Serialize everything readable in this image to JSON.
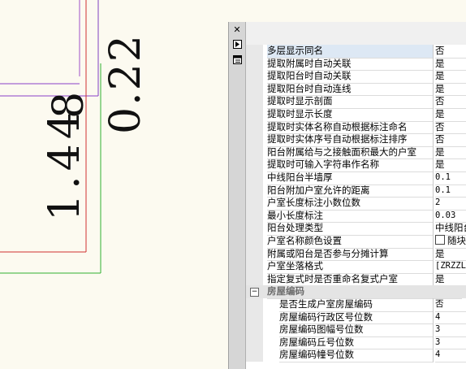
{
  "canvas": {
    "text_1": "1.44",
    "text_1_dot": "8",
    "text_2": "0.22"
  },
  "panel": {
    "close_glyph": "✕",
    "properties": [
      {
        "name": "多层显示同名",
        "value": "否"
      },
      {
        "name": "提取附属时自动关联",
        "value": "是"
      },
      {
        "name": "提取阳台时自动关联",
        "value": "是"
      },
      {
        "name": "提取阳台时自动连线",
        "value": "是"
      },
      {
        "name": "提取时显示剖面",
        "value": "否"
      },
      {
        "name": "提取时显示长度",
        "value": "是"
      },
      {
        "name": "提取时实体名称自动根据标注命名",
        "value": "否"
      },
      {
        "name": "提取时实体序号自动根据标注排序",
        "value": "否"
      },
      {
        "name": "阳台附属给与之接触面积最大的户室",
        "value": "是"
      },
      {
        "name": "提取时可输入字符串作名称",
        "value": "是"
      },
      {
        "name": "中线阳台半墙厚",
        "value": "0.1"
      },
      {
        "name": "阳台附加户室允许的距离",
        "value": "0.1"
      },
      {
        "name": "户室长度标注小数位数",
        "value": "2"
      },
      {
        "name": "最小长度标注",
        "value": "0.03"
      },
      {
        "name": "阳台处理类型",
        "value": "中线阳台"
      },
      {
        "name": "户室名称颜色设置",
        "value": "随块"
      },
      {
        "name": "附属或阳台是否参与分摊计算",
        "value": "是"
      },
      {
        "name": "户室坐落格式",
        "value": "[ZRZZL]"
      },
      {
        "name": "指定复式时是否重命名复式户室",
        "value": "是"
      }
    ],
    "category": {
      "name": "房屋编码",
      "toggle": "⊟"
    },
    "sub_properties": [
      {
        "name": "是否生成户室房屋编码",
        "value": "否"
      },
      {
        "name": "房屋编码行政区号位数",
        "value": "4"
      },
      {
        "name": "房屋编码图幅号位数",
        "value": "3"
      },
      {
        "name": "房屋编码丘号位数",
        "value": "3"
      },
      {
        "name": "房屋编码幢号位数",
        "value": "4"
      }
    ]
  }
}
